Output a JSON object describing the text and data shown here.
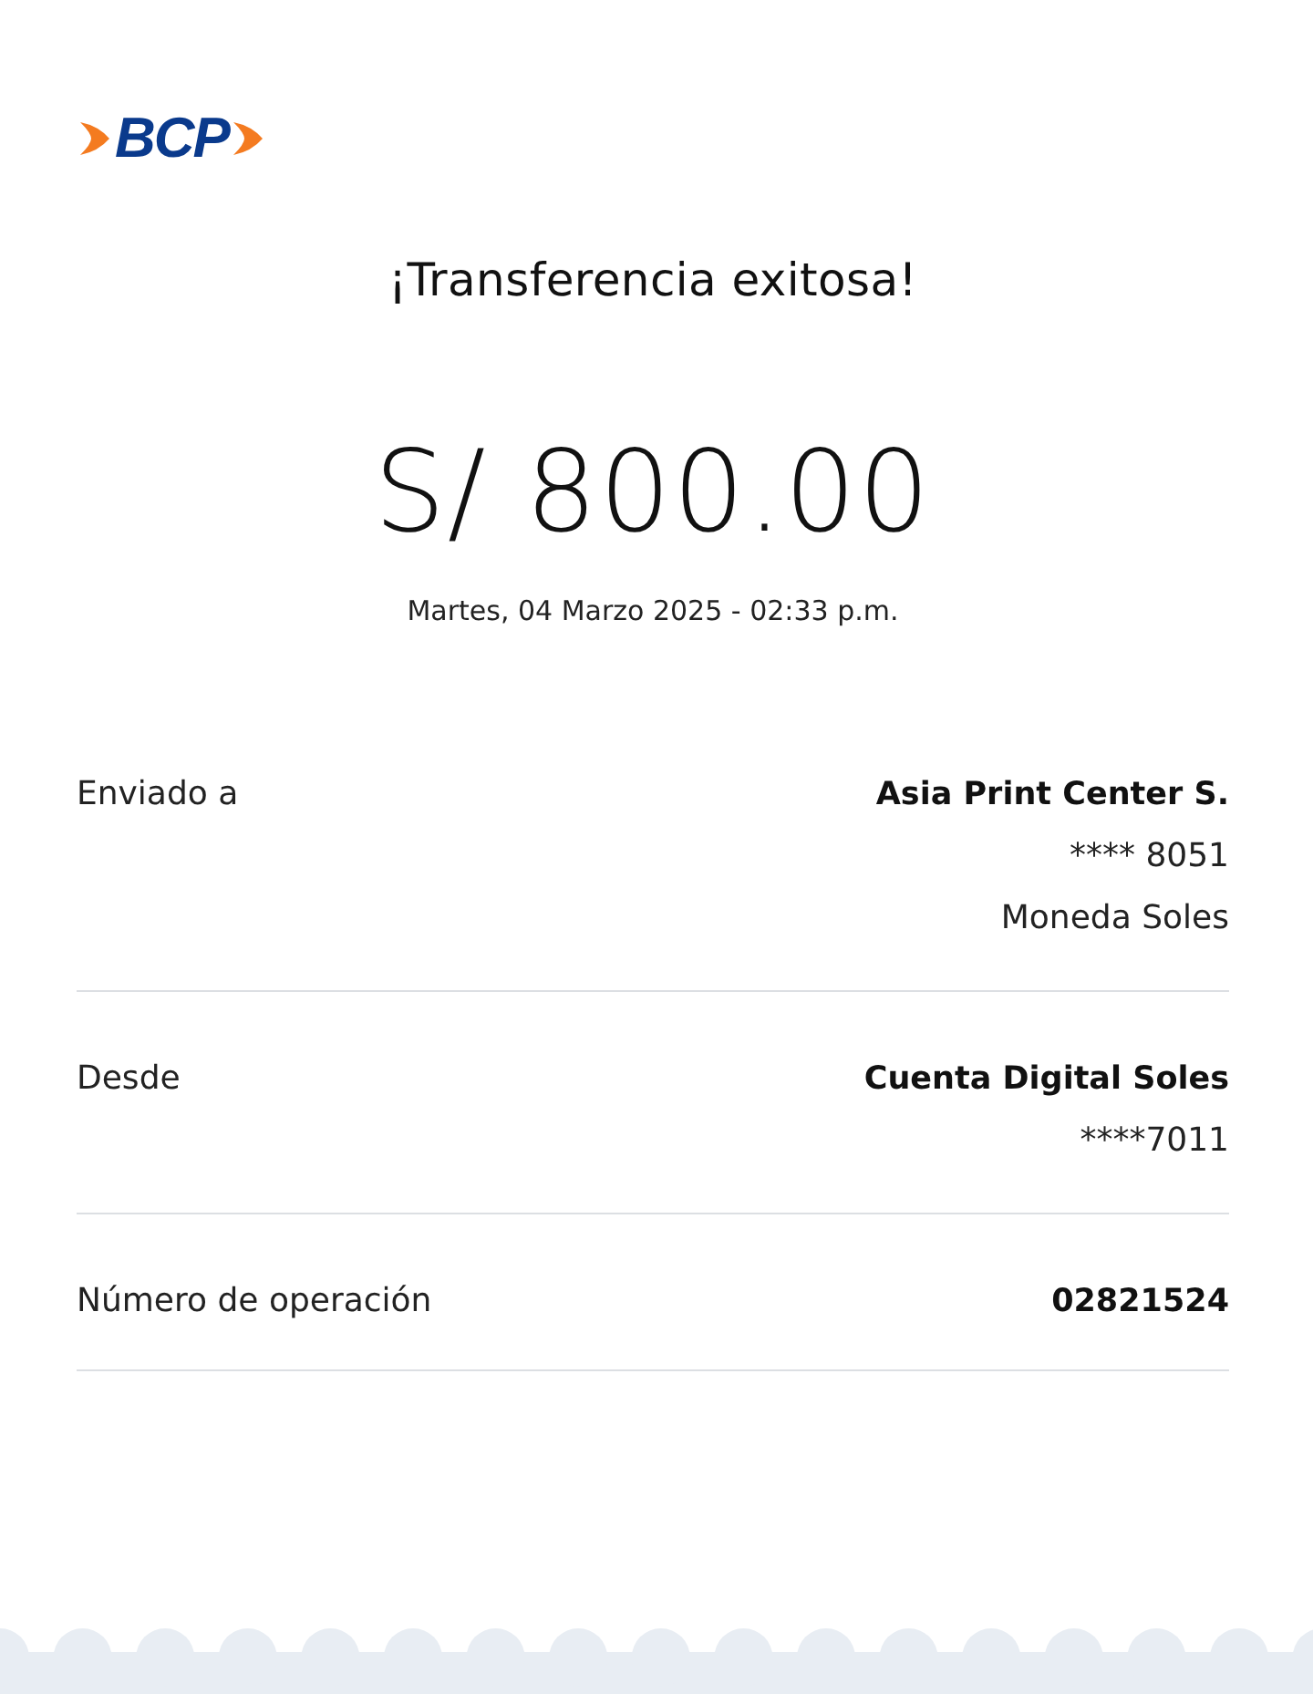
{
  "logo": {
    "text": "BCP"
  },
  "title": "¡Transferencia exitosa!",
  "amount": "S/ 800.00",
  "datetime": "Martes, 04 Marzo 2025 - 02:33 p.m.",
  "details": [
    {
      "label": "Enviado a",
      "values": [
        "Asia Print Center S.",
        "**** 8051",
        "Moneda Soles"
      ]
    },
    {
      "label": "Desde",
      "values": [
        "Cuenta Digital Soles",
        "****7011"
      ]
    },
    {
      "label": "Número de operación",
      "values": [
        "02821524"
      ]
    }
  ]
}
